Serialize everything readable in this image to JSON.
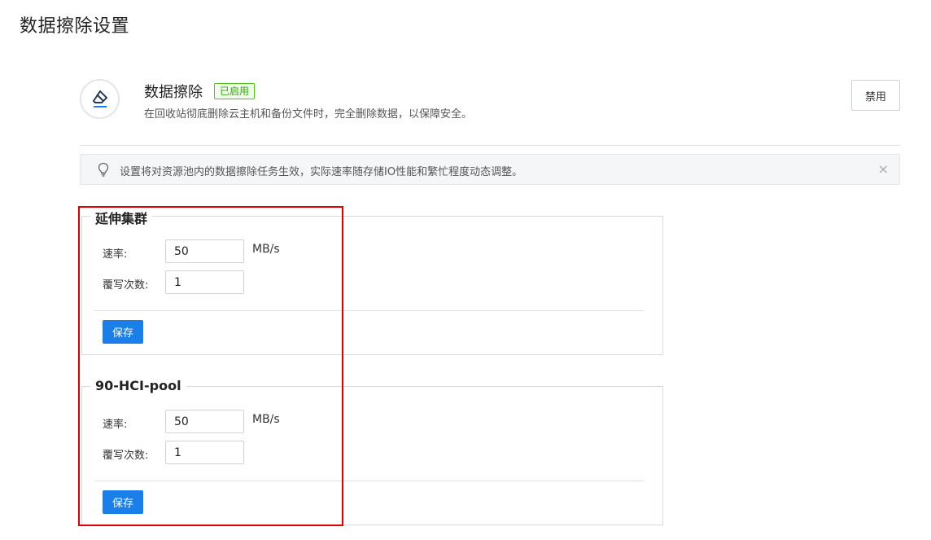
{
  "page": {
    "title": "数据擦除设置"
  },
  "feature": {
    "name": "数据擦除",
    "status": "已启用",
    "description": "在回收站彻底删除云主机和备份文件时，完全删除数据，以保障安全。",
    "disable_label": "禁用",
    "icon": "eraser-icon"
  },
  "notice": {
    "text": "设置将对资源池内的数据擦除任务生效，实际速率随存储IO性能和繁忙程度动态调整。",
    "icon": "lightbulb-icon",
    "close_label": "×"
  },
  "clusters": [
    {
      "name": "延伸集群",
      "rate_label": "速率:",
      "rate_value": "50",
      "rate_unit": "MB/s",
      "overwrite_label": "覆写次数:",
      "overwrite_value": "1",
      "save_label": "保存"
    },
    {
      "name": "90-HCI-pool",
      "rate_label": "速率:",
      "rate_value": "50",
      "rate_unit": "MB/s",
      "overwrite_label": "覆写次数:",
      "overwrite_value": "1",
      "save_label": "保存"
    }
  ],
  "colors": {
    "primary": "#1a7fe8",
    "status_green": "#52c41a",
    "highlight_red": "#e00000"
  }
}
